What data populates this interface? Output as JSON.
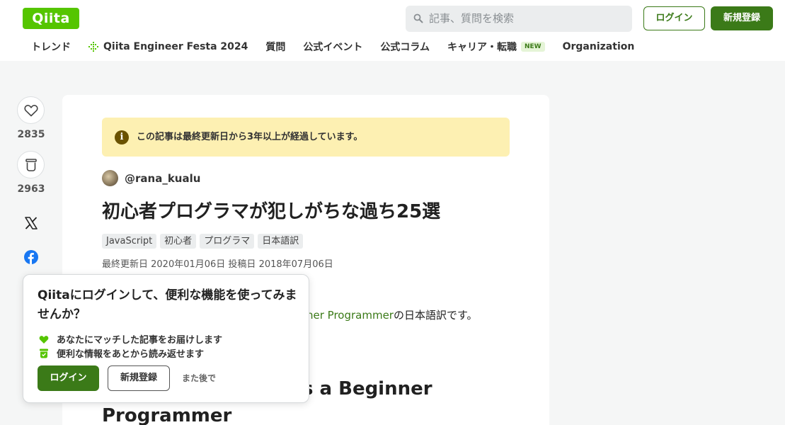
{
  "header": {
    "logo": "Qiita",
    "search_placeholder": "記事、質問を検索",
    "login_label": "ログイン",
    "signup_label": "新規登録"
  },
  "nav": {
    "items": [
      {
        "label": "トレンド"
      },
      {
        "label": "Qiita Engineer Festa 2024"
      },
      {
        "label": "質問"
      },
      {
        "label": "公式イベント"
      },
      {
        "label": "公式コラム"
      },
      {
        "label": "キャリア・転職",
        "badge": "NEW"
      },
      {
        "label": "Organization"
      }
    ]
  },
  "actions": {
    "like_count": "2835",
    "stock_count": "2963"
  },
  "article": {
    "notice": "この記事は最終更新日から3年以上が経過しています。",
    "author": "@rana_kualu",
    "title": "初心者プログラマが犯しがちな過ち25選",
    "tags": [
      "JavaScript",
      "初心者",
      "プログラマ",
      "日本語訳"
    ],
    "dates": "最終更新日 2020年01月06日  投稿日 2018年07月06日",
    "intro_link": "ner Programmer",
    "intro_rest": "の日本語訳です。",
    "heading_visible": "s a Beginner Programmer",
    "heading_line1": "s a Beginner",
    "heading_line2": "Programmer"
  },
  "popup": {
    "title": "Qiitaにログインして、便利な機能を使ってみませんか？",
    "benefits": [
      "あなたにマッチした記事をお届けします",
      "便利な情報をあとから読み返せます"
    ],
    "login_label": "ログイン",
    "signup_label": "新規登録",
    "later_label": "また後で"
  },
  "colors": {
    "brand": "#55c500",
    "primary_button": "#3b7a18",
    "notice_bg": "#fdf0b2"
  }
}
